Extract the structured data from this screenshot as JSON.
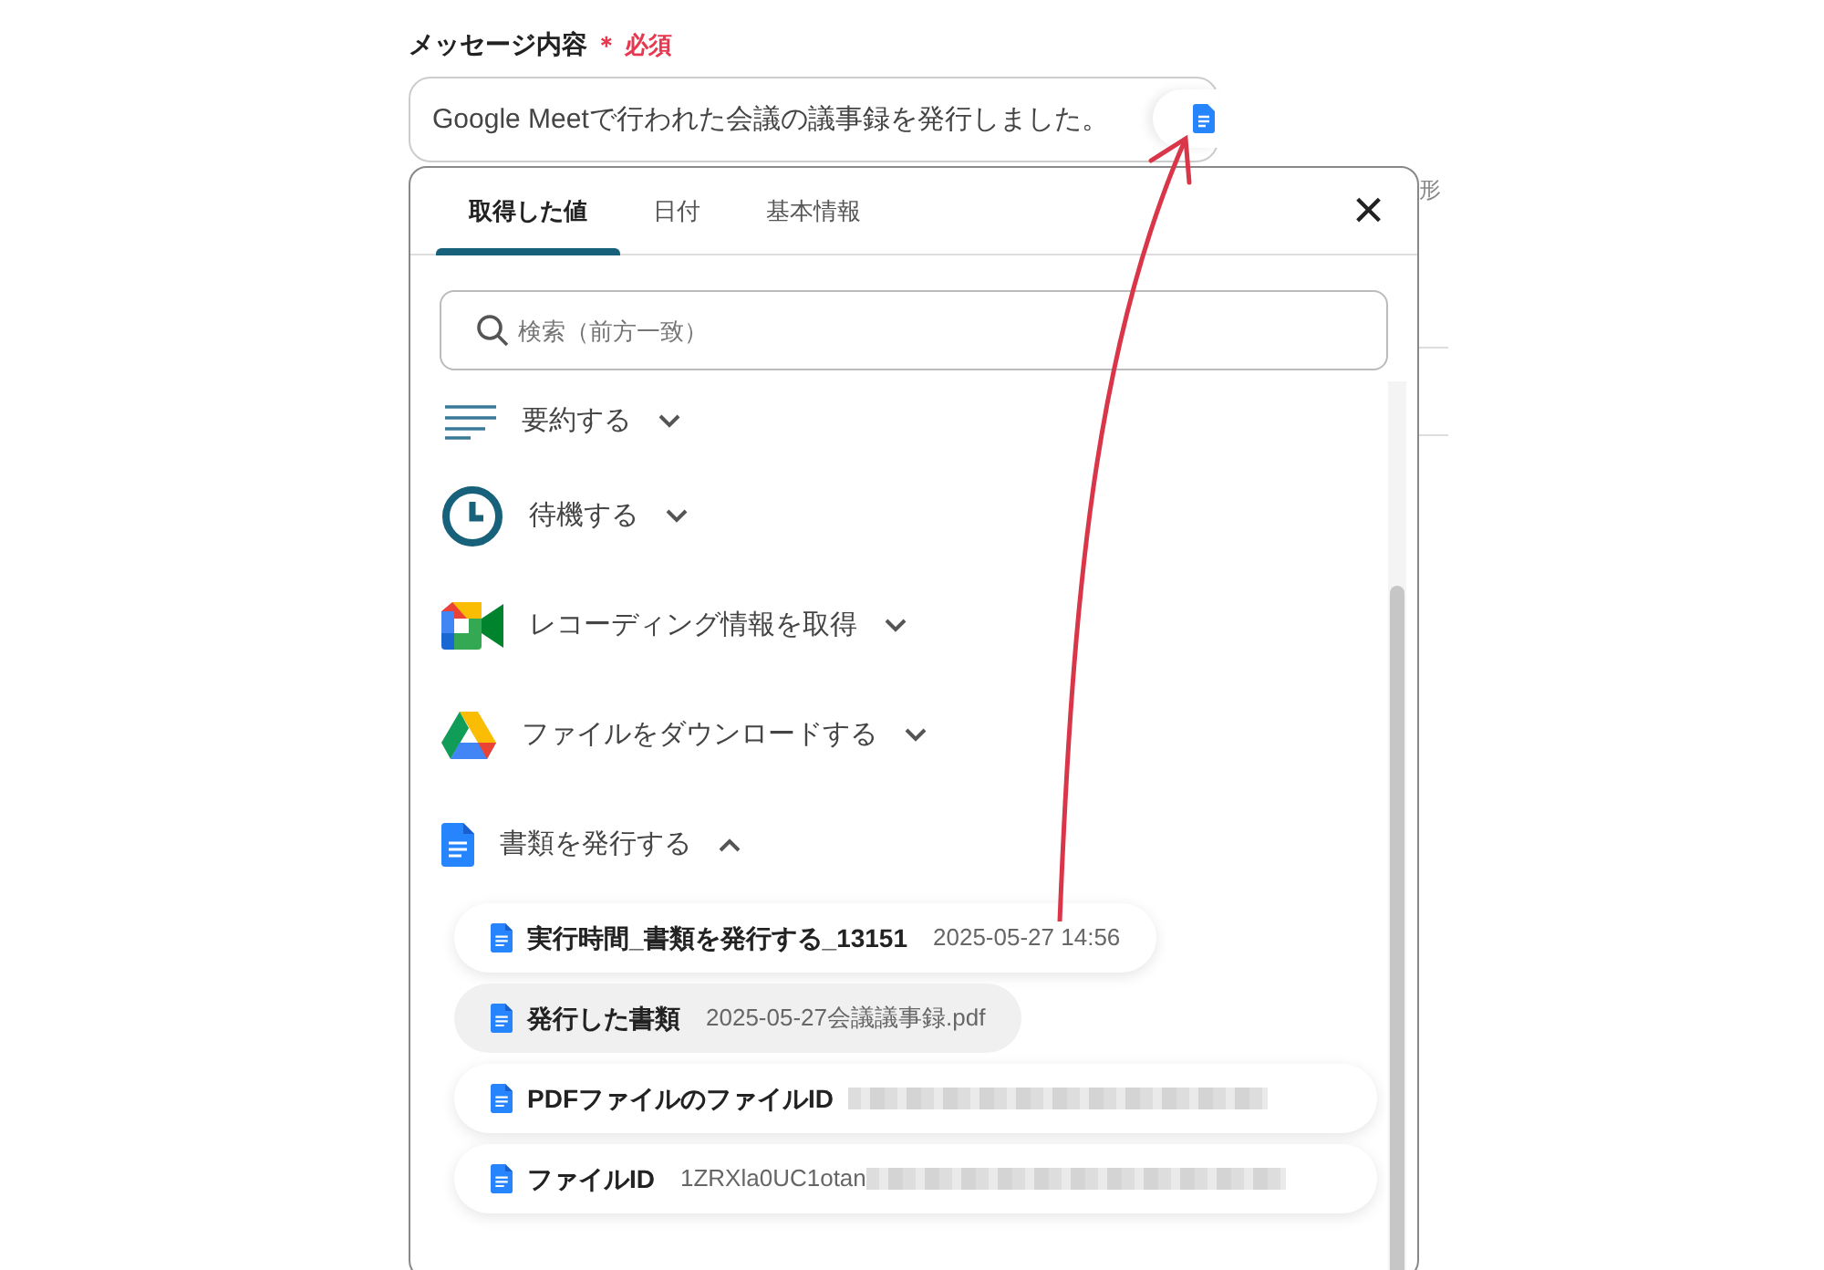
{
  "field": {
    "label": "メッセージ内容",
    "required_mark": "＊",
    "required_text": "必須",
    "value": "Google Meetで行われた会議の議事録を発行しました。"
  },
  "side_text": "形",
  "panel": {
    "tabs": [
      {
        "label": "取得した値",
        "selected": true
      },
      {
        "label": "日付",
        "selected": false
      },
      {
        "label": "基本情報",
        "selected": false
      }
    ],
    "close": "×",
    "search": {
      "placeholder": "検索（前方一致）"
    },
    "groups": [
      {
        "kind": "summary",
        "label": "要約する",
        "expanded": false
      },
      {
        "kind": "wait",
        "label": "待機する",
        "expanded": false
      },
      {
        "kind": "meet",
        "label": "レコーディング情報を取得",
        "expanded": false
      },
      {
        "kind": "drive",
        "label": "ファイルをダウンロードする",
        "expanded": false
      },
      {
        "kind": "docs",
        "label": "書類を発行する",
        "expanded": true,
        "children": [
          {
            "label": "実行時間_書類を発行する_13151",
            "value": "2025-05-27 14:56",
            "redacted": false,
            "selected": false
          },
          {
            "label": "発行した書類",
            "value": "2025-05-27会議議事録.pdf",
            "redacted": false,
            "selected": true
          },
          {
            "label": "PDFファイルのファイルID",
            "redacted": true,
            "selected": false
          },
          {
            "label": "ファイルID",
            "value": "1ZRXla0UC1otan",
            "redacted": true,
            "selected": false
          }
        ]
      }
    ]
  }
}
